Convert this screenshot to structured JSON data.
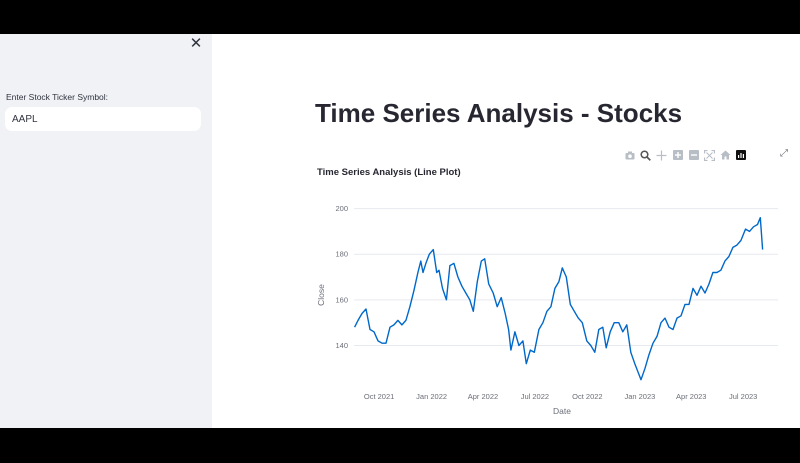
{
  "sidebar": {
    "close_icon": "close-icon",
    "ticker_label": "Enter Stock Ticker Symbol:",
    "ticker_value": "AAPL"
  },
  "main": {
    "title": "Time Series Analysis - Stocks"
  },
  "toolbar": {
    "icons": [
      "camera-icon",
      "zoom-icon",
      "pan-icon",
      "zoom-in-icon",
      "zoom-out-icon",
      "autoscale-icon",
      "reset-axes-icon",
      "plotly-logo-icon"
    ],
    "fullscreen_icon": "fullscreen-icon"
  },
  "colors": {
    "line": "#0068c9",
    "sidebar_bg": "#f0f2f6",
    "grid": "#e6e9ef"
  },
  "chart_data": {
    "type": "line",
    "title": "Time Series Analysis (Line Plot)",
    "xlabel": "Date",
    "ylabel": "Close",
    "ylim": [
      124,
      202
    ],
    "xlim": [
      "2021-08-18",
      "2023-08-31"
    ],
    "grid": true,
    "x_ticks": [
      "Oct 2021",
      "Jan 2022",
      "Apr 2022",
      "Jul 2022",
      "Oct 2022",
      "Jan 2023",
      "Apr 2023",
      "Jul 2023"
    ],
    "y_ticks": [
      140,
      160,
      180,
      200
    ],
    "series": [
      {
        "x": [
          "2021-08-19",
          "2021-08-25",
          "2021-09-01",
          "2021-09-08",
          "2021-09-15",
          "2021-09-22",
          "2021-09-29",
          "2021-10-06",
          "2021-10-13",
          "2021-10-20",
          "2021-10-27",
          "2021-11-03",
          "2021-11-10",
          "2021-11-17",
          "2021-11-24",
          "2021-12-01",
          "2021-12-08",
          "2021-12-13",
          "2021-12-17",
          "2021-12-22",
          "2021-12-28",
          "2022-01-04",
          "2022-01-10",
          "2022-01-14",
          "2022-01-20",
          "2022-01-27",
          "2022-02-02",
          "2022-02-09",
          "2022-02-16",
          "2022-02-23",
          "2022-03-02",
          "2022-03-09",
          "2022-03-15",
          "2022-03-22",
          "2022-03-29",
          "2022-04-04",
          "2022-04-11",
          "2022-04-19",
          "2022-04-26",
          "2022-05-03",
          "2022-05-10",
          "2022-05-16",
          "2022-05-20",
          "2022-05-27",
          "2022-06-03",
          "2022-06-10",
          "2022-06-16",
          "2022-06-23",
          "2022-06-30",
          "2022-07-08",
          "2022-07-15",
          "2022-07-22",
          "2022-07-29",
          "2022-08-05",
          "2022-08-12",
          "2022-08-18",
          "2022-08-25",
          "2022-09-01",
          "2022-09-08",
          "2022-09-15",
          "2022-09-22",
          "2022-09-30",
          "2022-10-07",
          "2022-10-14",
          "2022-10-21",
          "2022-10-28",
          "2022-11-03",
          "2022-11-10",
          "2022-11-17",
          "2022-11-25",
          "2022-12-02",
          "2022-12-09",
          "2022-12-16",
          "2022-12-23",
          "2023-01-03",
          "2023-01-10",
          "2023-01-17",
          "2023-01-24",
          "2023-01-31",
          "2023-02-07",
          "2023-02-14",
          "2023-02-21",
          "2023-02-28",
          "2023-03-07",
          "2023-03-14",
          "2023-03-21",
          "2023-03-28",
          "2023-04-04",
          "2023-04-11",
          "2023-04-18",
          "2023-04-25",
          "2023-05-02",
          "2023-05-09",
          "2023-05-16",
          "2023-05-23",
          "2023-05-30",
          "2023-06-06",
          "2023-06-13",
          "2023-06-20",
          "2023-06-27",
          "2023-07-05",
          "2023-07-12",
          "2023-07-19",
          "2023-07-26",
          "2023-07-31",
          "2023-08-04"
        ],
        "values": [
          148,
          151,
          154,
          156,
          147,
          146,
          142,
          141,
          141,
          148,
          149,
          151,
          149,
          151,
          157,
          164,
          172,
          177,
          172,
          176,
          180,
          182,
          172,
          173,
          165,
          160,
          175,
          176,
          170,
          166,
          163,
          160,
          155,
          168,
          177,
          178,
          167,
          163,
          157,
          161,
          154,
          147,
          138,
          146,
          140,
          142,
          132,
          138,
          137,
          147,
          150,
          155,
          157,
          165,
          168,
          174,
          170,
          158,
          155,
          152,
          150,
          142,
          140,
          137,
          147,
          148,
          139,
          146,
          150,
          150,
          146,
          149,
          137,
          132,
          125,
          130,
          136,
          141,
          144,
          150,
          152,
          148,
          147,
          152,
          153,
          158,
          158,
          165,
          162,
          166,
          163,
          167,
          172,
          172,
          173,
          177,
          179,
          183,
          184,
          186,
          191,
          190,
          192,
          193,
          196,
          182
        ]
      }
    ]
  }
}
